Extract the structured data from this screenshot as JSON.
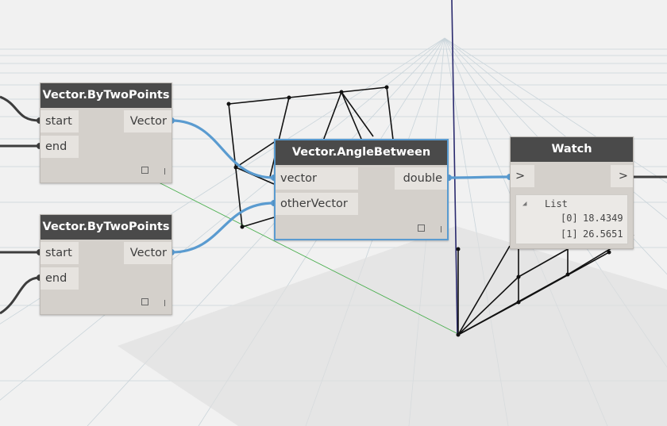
{
  "nodes": {
    "by_two_points_1": {
      "title": "Vector.ByTwoPoints",
      "inputs": [
        "start",
        "end"
      ],
      "output": "Vector"
    },
    "by_two_points_2": {
      "title": "Vector.ByTwoPoints",
      "inputs": [
        "start",
        "end"
      ],
      "output": "Vector"
    },
    "angle_between": {
      "title": "Vector.AngleBetween",
      "inputs": [
        "vector",
        "otherVector"
      ],
      "output": "double"
    },
    "watch": {
      "title": "Watch",
      "input": ">",
      "output": ">",
      "list": {
        "header": "List",
        "items": [
          {
            "index": "[0]",
            "value": "18.4349"
          },
          {
            "index": "[1]",
            "value": "26.5651"
          }
        ]
      }
    }
  },
  "footer_glyph": "|",
  "collapse_glyph": "◢",
  "colors": {
    "background": "#f1f1f1",
    "node_header": "#4a4a4a",
    "node_body": "#d4d0cb",
    "wire": "#5a9bd0",
    "selected_border": "#5a9bd0"
  }
}
